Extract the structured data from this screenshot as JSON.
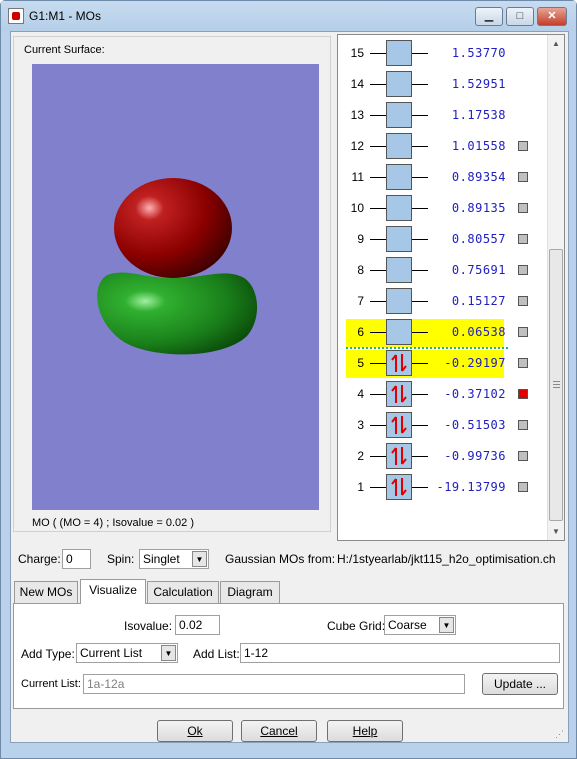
{
  "window": {
    "title": "G1:M1 - MOs",
    "minimize": "▁",
    "maximize": "□",
    "close": "✕"
  },
  "surface": {
    "label": "Current Surface:",
    "caption": "MO ( (MO = 4) ; Isovalue = 0.02 )",
    "background": "#8080cc",
    "lobe_colors": [
      "#8b0000",
      "#1f8a1f"
    ]
  },
  "mo_list": [
    {
      "num": "15",
      "energy": "1.53770",
      "occupied": false,
      "highlighted": false,
      "selector": false
    },
    {
      "num": "14",
      "energy": "1.52951",
      "occupied": false,
      "highlighted": false,
      "selector": false
    },
    {
      "num": "13",
      "energy": "1.17538",
      "occupied": false,
      "highlighted": false,
      "selector": false
    },
    {
      "num": "12",
      "energy": "1.01558",
      "occupied": false,
      "highlighted": false,
      "selector": true,
      "selected": false
    },
    {
      "num": "11",
      "energy": "0.89354",
      "occupied": false,
      "highlighted": false,
      "selector": true,
      "selected": false
    },
    {
      "num": "10",
      "energy": "0.89135",
      "occupied": false,
      "highlighted": false,
      "selector": true,
      "selected": false
    },
    {
      "num": "9",
      "energy": "0.80557",
      "occupied": false,
      "highlighted": false,
      "selector": true,
      "selected": false
    },
    {
      "num": "8",
      "energy": "0.75691",
      "occupied": false,
      "highlighted": false,
      "selector": true,
      "selected": false
    },
    {
      "num": "7",
      "energy": "0.15127",
      "occupied": false,
      "highlighted": false,
      "selector": true,
      "selected": false
    },
    {
      "num": "6",
      "energy": "0.06538",
      "occupied": false,
      "highlighted": true,
      "selector": true,
      "selected": false
    },
    {
      "num": "5",
      "energy": "-0.29197",
      "occupied": true,
      "highlighted": true,
      "selector": true,
      "selected": false
    },
    {
      "num": "4",
      "energy": "-0.37102",
      "occupied": true,
      "highlighted": false,
      "selector": true,
      "selected": true
    },
    {
      "num": "3",
      "energy": "-0.51503",
      "occupied": true,
      "highlighted": false,
      "selector": true,
      "selected": false
    },
    {
      "num": "2",
      "energy": "-0.99736",
      "occupied": true,
      "highlighted": false,
      "selector": true,
      "selected": false
    },
    {
      "num": "1",
      "energy": "-19.13799",
      "occupied": true,
      "highlighted": false,
      "selector": true,
      "selected": false
    }
  ],
  "charge": {
    "label": "Charge:",
    "value": "0"
  },
  "spin": {
    "label": "Spin:",
    "value": "Singlet"
  },
  "source": {
    "label": "Gaussian MOs from:",
    "path": "H:/1styearlab/jkt115_h2o_optimisation.ch"
  },
  "tabs": [
    {
      "label": "New MOs",
      "active": false
    },
    {
      "label": "Visualize",
      "active": true
    },
    {
      "label": "Calculation",
      "active": false
    },
    {
      "label": "Diagram",
      "active": false
    }
  ],
  "visualize": {
    "isovalue_label": "Isovalue:",
    "isovalue": "0.02",
    "cube_grid_label": "Cube Grid:",
    "cube_grid": "Coarse",
    "add_type_label": "Add Type:",
    "add_type": "Current List",
    "add_list_label": "Add List:",
    "add_list": "1-12",
    "current_list_label": "Current List:",
    "current_list": "1a-12a",
    "update_label": "Update ..."
  },
  "buttons": {
    "ok": "Ok",
    "cancel": "Cancel",
    "help": "Help"
  },
  "colors": {
    "highlight": "#ffff00",
    "energy_text": "#2020c0",
    "orbital_box": "#a7c7e7",
    "selected_square": "#e00000",
    "electron_arrow": "#e00000"
  }
}
